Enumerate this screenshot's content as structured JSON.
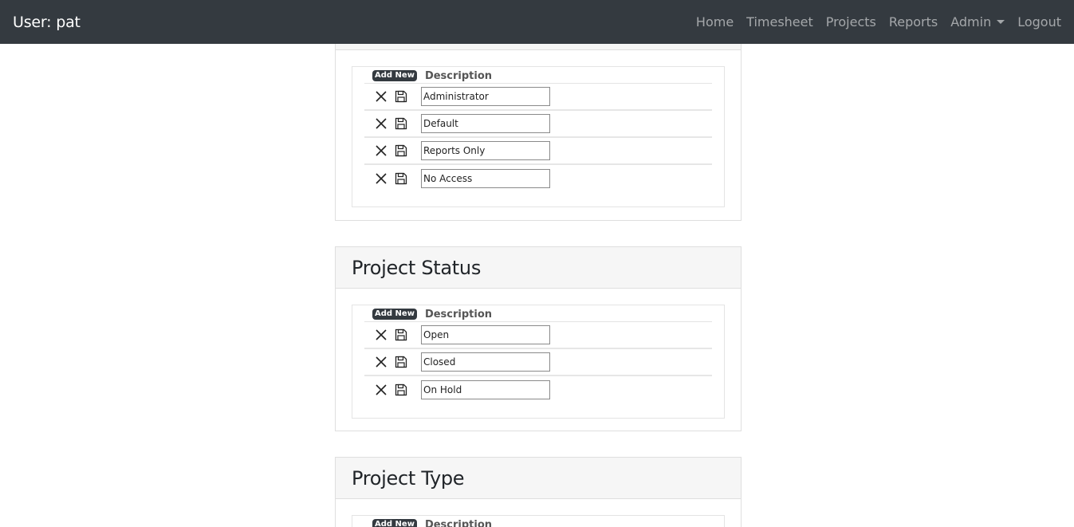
{
  "navbar": {
    "brand": "User: pat",
    "links": [
      "Home",
      "Timesheet",
      "Projects",
      "Reports",
      "Admin",
      "Logout"
    ]
  },
  "sections": [
    {
      "title": "",
      "add_new_label": "Add New",
      "column_header": "Description",
      "rows": [
        "Administrator",
        "Default",
        "Reports Only",
        "No Access"
      ]
    },
    {
      "title": "Project Status",
      "add_new_label": "Add New",
      "column_header": "Description",
      "rows": [
        "Open",
        "Closed",
        "On Hold"
      ]
    },
    {
      "title": "Project Type",
      "add_new_label": "Add New",
      "column_header": "Description",
      "rows": []
    }
  ],
  "icons": {
    "delete": "close-icon",
    "save": "floppy-disk-icon"
  },
  "colors": {
    "navbar_bg": "#343a40",
    "header_bg": "#f6f6f6"
  }
}
